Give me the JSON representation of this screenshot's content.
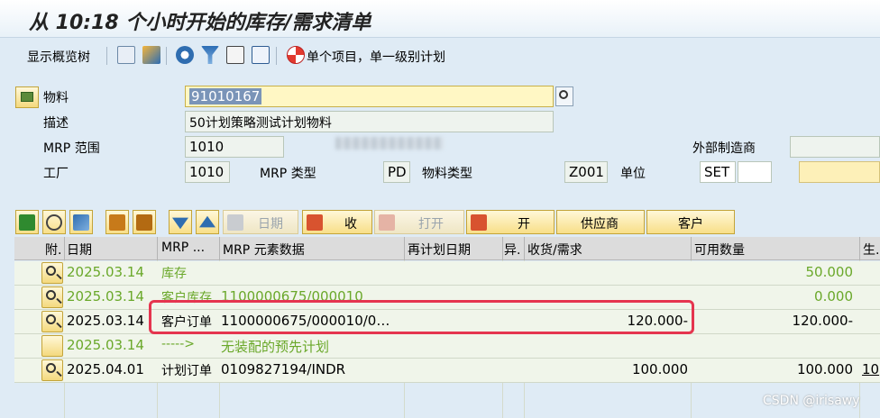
{
  "title": "从 10:18 个小时开始的库存/需求清单",
  "toolbar": {
    "overview_tree": "显示概览树",
    "single_item": "单个项目，单一级别计划",
    "icons": [
      "new-page-icon",
      "mountain-icon",
      "refresh-icon",
      "filter-icon",
      "download-icon",
      "export-icon",
      "lifebuoy-icon"
    ]
  },
  "header": {
    "material_label": "物料",
    "material_value": "91010167",
    "description_label": "描述",
    "description_value": "50计划策略测试计划物料",
    "mrp_area_label": "MRP 范围",
    "mrp_area_value": "1010",
    "plant_label": "工厂",
    "plant_value": "1010",
    "mrp_type_label": "MRP 类型",
    "mrp_type_value": "PD",
    "material_type_label": "物料类型",
    "material_type_value": "Z001",
    "unit_label": "单位",
    "unit_value": "SET",
    "external_label": "外部制造商"
  },
  "buttons": {
    "date": "日期",
    "receive": "收",
    "open": "打开",
    "open2": "开",
    "vendor": "供应商",
    "customer": "客户"
  },
  "grid": {
    "headers": [
      "附.",
      "日期",
      "MRP ...",
      "MRP 元素数据",
      "再计划日期",
      "异.",
      "收货/需求",
      "可用数量",
      "生."
    ],
    "rows": [
      {
        "date": "2025.03.14",
        "mrp": "库存",
        "elem": "",
        "qty": "",
        "avail": "50.000",
        "extra": "",
        "green": true,
        "btn": true
      },
      {
        "date": "2025.03.14",
        "mrp": "客户库存",
        "elem": "1100000675/000010",
        "qty": "",
        "avail": "0.000",
        "extra": "",
        "green": true,
        "btn": true
      },
      {
        "date": "2025.03.14",
        "mrp": "客户订单",
        "elem": "1100000675/000010/0…",
        "qty": "120.000-",
        "avail": "120.000-",
        "extra": "",
        "green": false,
        "btn": true
      },
      {
        "date": "2025.03.14",
        "mrp": "----->",
        "elem": "无装配的预先计划",
        "qty": "",
        "avail": "",
        "extra": "",
        "green": true,
        "btn": false
      },
      {
        "date": "2025.04.01",
        "mrp": "计划订单",
        "elem": "0109827194/INDR",
        "qty": "100.000",
        "avail": "100.000",
        "extra": "10",
        "green": false,
        "btn": true
      }
    ]
  },
  "watermark": "CSDN @irisawy",
  "colors": {
    "accent": "#f8df88",
    "highlight": "#e5354f",
    "green_text": "#6aa82a"
  }
}
